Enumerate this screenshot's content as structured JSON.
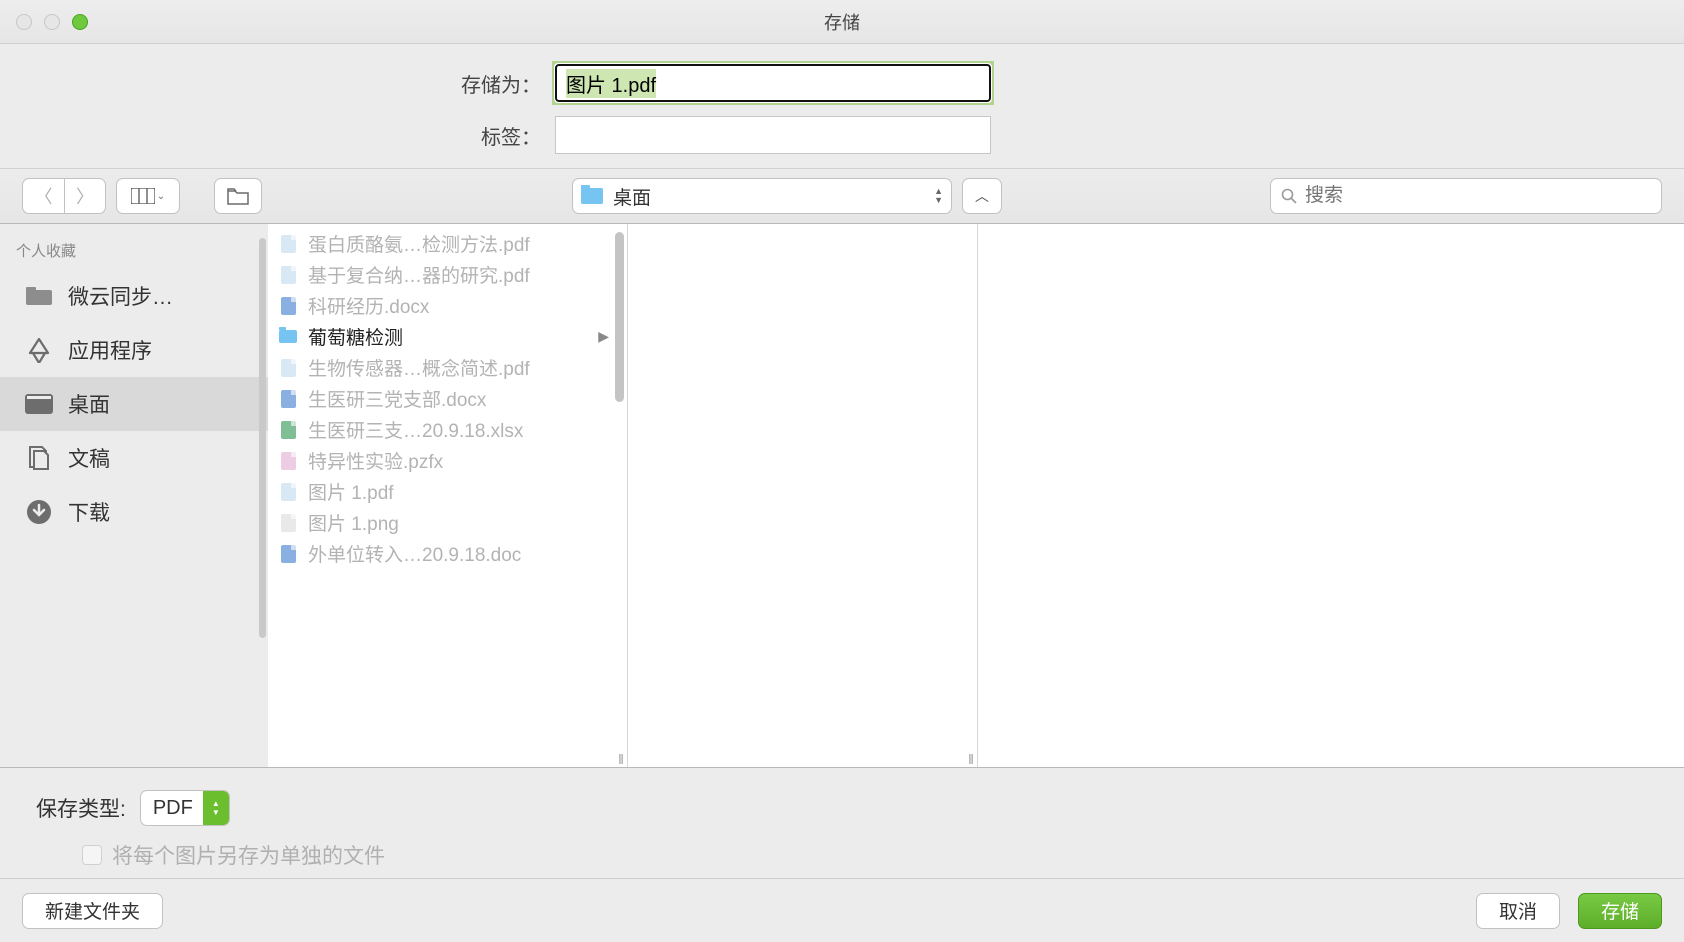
{
  "title": "存储",
  "fields": {
    "save_as_label": "存储为：",
    "save_as_value": "图片 1.pdf",
    "tags_label": "标签："
  },
  "toolbar": {
    "location": "桌面",
    "search_placeholder": "搜索"
  },
  "sidebar": {
    "heading": "个人收藏",
    "items": [
      {
        "label": "微云同步…",
        "icon": "folder"
      },
      {
        "label": "应用程序",
        "icon": "apps"
      },
      {
        "label": "桌面",
        "icon": "desktop",
        "selected": true
      },
      {
        "label": "文稿",
        "icon": "docs"
      },
      {
        "label": "下载",
        "icon": "downloads"
      }
    ]
  },
  "files": [
    {
      "name": "蛋白质酪氨…检测方法.pdf",
      "type": "pdf"
    },
    {
      "name": "基于复合纳…器的研究.pdf",
      "type": "pdf"
    },
    {
      "name": "科研经历.docx",
      "type": "docx"
    },
    {
      "name": "葡萄糖检测",
      "type": "folder",
      "active": true,
      "hasChildren": true
    },
    {
      "name": "生物传感器…概念简述.pdf",
      "type": "pdf"
    },
    {
      "name": "生医研三党支部.docx",
      "type": "docx"
    },
    {
      "name": "生医研三支…20.9.18.xlsx",
      "type": "xlsx"
    },
    {
      "name": "特异性实验.pzfx",
      "type": "pzfx"
    },
    {
      "name": "图片 1.pdf",
      "type": "pdf"
    },
    {
      "name": "图片 1.png",
      "type": "png"
    },
    {
      "name": "外单位转入…20.9.18.doc",
      "type": "doc"
    }
  ],
  "format": {
    "label": "保存类型:",
    "value": "PDF",
    "checkbox_label": "将每个图片另存为单独的文件"
  },
  "footer": {
    "new_folder": "新建文件夹",
    "cancel": "取消",
    "save": "存储"
  },
  "icon_colors": {
    "pdf": "#c8dff0",
    "docx": "#5a8fd6",
    "doc": "#5a8fd6",
    "xlsx": "#4ba56b",
    "png": "#e0e0e0",
    "pzfx": "#e6b8d8",
    "folder": "#76c4f2"
  }
}
